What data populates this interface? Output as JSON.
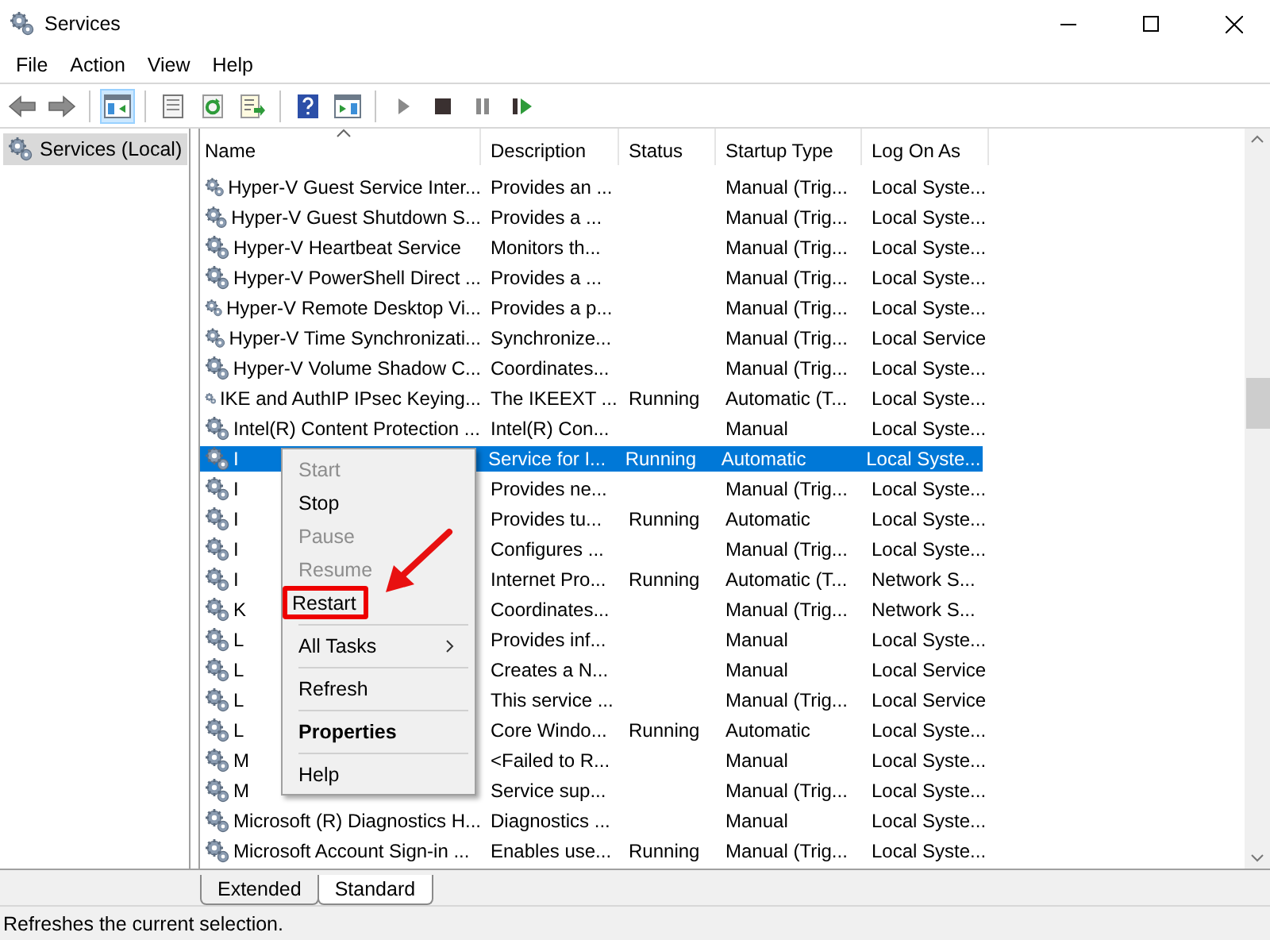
{
  "window": {
    "title": "Services"
  },
  "menu": [
    "File",
    "Action",
    "View",
    "Help"
  ],
  "toolbar": [
    {
      "buttons": [
        {
          "kind": "back",
          "selected": false
        },
        {
          "kind": "forward",
          "selected": false
        }
      ]
    },
    {
      "buttons": [
        {
          "kind": "tree",
          "selected": true
        }
      ]
    },
    {
      "buttons": [
        {
          "kind": "props",
          "selected": false
        },
        {
          "kind": "refresh",
          "selected": false
        },
        {
          "kind": "export",
          "selected": false
        }
      ]
    },
    {
      "buttons": [
        {
          "kind": "help",
          "selected": false
        },
        {
          "kind": "pane",
          "selected": false
        }
      ]
    },
    {
      "buttons": [
        {
          "kind": "play",
          "selected": false
        },
        {
          "kind": "stop",
          "selected": false
        },
        {
          "kind": "pause",
          "selected": false
        },
        {
          "kind": "resume",
          "selected": false
        }
      ]
    }
  ],
  "sidebar": {
    "items": [
      {
        "label": "Services (Local)",
        "selected": true
      }
    ]
  },
  "table": {
    "columns": [
      "Name",
      "Description",
      "Status",
      "Startup Type",
      "Log On As"
    ],
    "rows": [
      {
        "cells": [
          "Hyper-V Guest Service Inter...",
          "Provides an ...",
          "",
          "Manual (Trig...",
          "Local Syste..."
        ],
        "selected": false
      },
      {
        "cells": [
          "Hyper-V Guest Shutdown S...",
          "Provides a ...",
          "",
          "Manual (Trig...",
          "Local Syste..."
        ],
        "selected": false
      },
      {
        "cells": [
          "Hyper-V Heartbeat Service",
          "Monitors th...",
          "",
          "Manual (Trig...",
          "Local Syste..."
        ],
        "selected": false
      },
      {
        "cells": [
          "Hyper-V PowerShell Direct ...",
          "Provides a ...",
          "",
          "Manual (Trig...",
          "Local Syste..."
        ],
        "selected": false
      },
      {
        "cells": [
          "Hyper-V Remote Desktop Vi...",
          "Provides a p...",
          "",
          "Manual (Trig...",
          "Local Syste..."
        ],
        "selected": false
      },
      {
        "cells": [
          "Hyper-V Time Synchronizati...",
          "Synchronize...",
          "",
          "Manual (Trig...",
          "Local Service"
        ],
        "selected": false
      },
      {
        "cells": [
          "Hyper-V Volume Shadow C...",
          "Coordinates...",
          "",
          "Manual (Trig...",
          "Local Syste..."
        ],
        "selected": false
      },
      {
        "cells": [
          "IKE and AuthIP IPsec Keying...",
          "The IKEEXT ...",
          "Running",
          "Automatic (T...",
          "Local Syste..."
        ],
        "selected": false
      },
      {
        "cells": [
          "Intel(R) Content Protection ...",
          "Intel(R) Con...",
          "",
          "Manual",
          "Local Syste..."
        ],
        "selected": false
      },
      {
        "cells": [
          "I",
          "Service for I...",
          "Running",
          "Automatic",
          "Local Syste..."
        ],
        "selected": true
      },
      {
        "cells": [
          "I",
          "Provides ne...",
          "",
          "Manual (Trig...",
          "Local Syste..."
        ],
        "selected": false
      },
      {
        "cells": [
          "I",
          "Provides tu...",
          "Running",
          "Automatic",
          "Local Syste..."
        ],
        "selected": false
      },
      {
        "cells": [
          "I",
          "Configures ...",
          "",
          "Manual (Trig...",
          "Local Syste..."
        ],
        "selected": false
      },
      {
        "cells": [
          "I",
          "Internet Pro...",
          "Running",
          "Automatic (T...",
          "Network S..."
        ],
        "selected": false
      },
      {
        "cells": [
          "K",
          "Coordinates...",
          "",
          "Manual (Trig...",
          "Network S..."
        ],
        "selected": false
      },
      {
        "cells": [
          "L",
          "Provides inf...",
          "",
          "Manual",
          "Local Syste..."
        ],
        "selected": false
      },
      {
        "cells": [
          "L",
          "Creates a N...",
          "",
          "Manual",
          "Local Service"
        ],
        "selected": false
      },
      {
        "cells": [
          "L",
          "This service ...",
          "",
          "Manual (Trig...",
          "Local Service"
        ],
        "selected": false
      },
      {
        "cells": [
          "L",
          "Core Windo...",
          "Running",
          "Automatic",
          "Local Syste..."
        ],
        "selected": false
      },
      {
        "cells": [
          "M",
          "<Failed to R...",
          "",
          "Manual",
          "Local Syste..."
        ],
        "selected": false
      },
      {
        "cells": [
          "M",
          "Service sup...",
          "",
          "Manual (Trig...",
          "Local Syste..."
        ],
        "selected": false
      },
      {
        "cells": [
          "Microsoft (R) Diagnostics H...",
          "Diagnostics ...",
          "",
          "Manual",
          "Local Syste..."
        ],
        "selected": false
      },
      {
        "cells": [
          "Microsoft Account Sign-in ...",
          "Enables use...",
          "Running",
          "Manual (Trig...",
          "Local Syste..."
        ],
        "selected": false
      }
    ]
  },
  "context_menu": {
    "items": [
      {
        "kind": "item",
        "label": "Start",
        "disabled": true,
        "highlighted": false
      },
      {
        "kind": "item",
        "label": "Stop",
        "disabled": false,
        "highlighted": false
      },
      {
        "kind": "item",
        "label": "Pause",
        "disabled": true,
        "highlighted": false
      },
      {
        "kind": "item",
        "label": "Resume",
        "disabled": true,
        "highlighted": false
      },
      {
        "kind": "item",
        "label": "Restart",
        "disabled": false,
        "highlighted": true
      },
      {
        "kind": "separator"
      },
      {
        "kind": "submenu",
        "label": "All Tasks",
        "disabled": false,
        "highlighted": false
      },
      {
        "kind": "separator"
      },
      {
        "kind": "item",
        "label": "Refresh",
        "disabled": false,
        "highlighted": false
      },
      {
        "kind": "separator"
      },
      {
        "kind": "default",
        "label": "Properties",
        "disabled": false,
        "highlighted": false
      },
      {
        "kind": "separator"
      },
      {
        "kind": "item",
        "label": "Help",
        "disabled": false,
        "highlighted": false
      }
    ]
  },
  "tabs": [
    {
      "label": "Extended",
      "selected": false
    },
    {
      "label": "Standard",
      "selected": true
    }
  ],
  "status_bar": "Refreshes the current selection."
}
